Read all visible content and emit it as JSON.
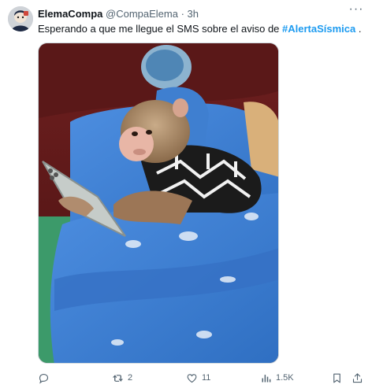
{
  "tweet": {
    "author_name": "ElemaCompa",
    "handle": "@CompaElema",
    "separator": "·",
    "time": "3h",
    "text_before": "Esperando a que me llegue el SMS sobre el aviso de ",
    "hashtag": "#AlertaSísmica",
    "text_after": " .",
    "more_label": "···"
  },
  "actions": {
    "replies": "",
    "retweets": "2",
    "likes": "11",
    "views": "1.5K"
  },
  "colors": {
    "accent": "#1d9bf0",
    "muted": "#536471",
    "bedding": "#3f7fd0"
  }
}
